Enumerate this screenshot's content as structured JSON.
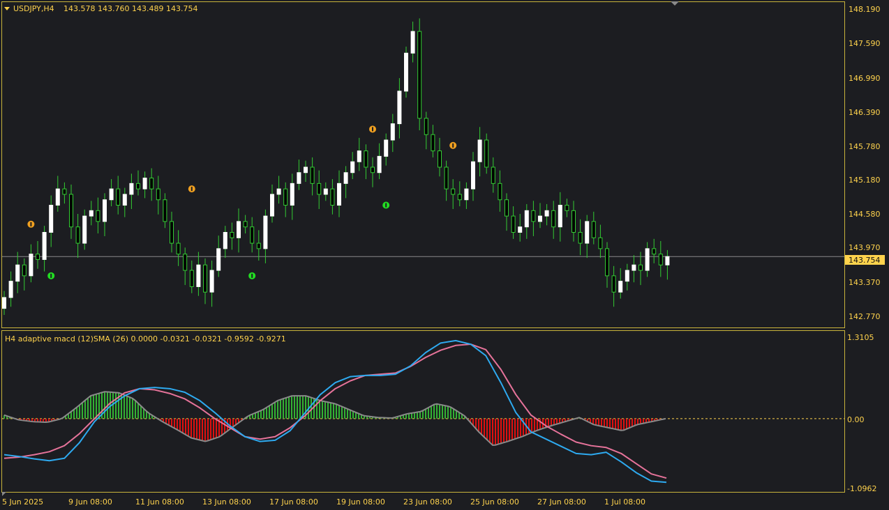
{
  "colors": {
    "background": "#1c1d21",
    "frame": "#c9b43c",
    "text": "#ffd34d",
    "bull_body": "#ffffff",
    "wick": "#33cc33",
    "current_line": "#8a8a8a",
    "current_label_bg": "#ffd34d",
    "current_label_text": "#111111",
    "macd_line": "#2eaaf0",
    "signal_line": "#e6739a",
    "hist_positive": "#33b233",
    "hist_negative": "#e01010",
    "hist_outline": "#8a8a8a",
    "up_marker": "#f0a020",
    "down_marker": "#22dd22",
    "zero_line": "#ffd34d"
  },
  "header": {
    "symbol": "USDJPY,H4",
    "ohlc": "143.578 143.760 143.489 143.754",
    "indicator_label": "H4 adaptive macd (12)SMA (26) 0.0000 -0.0321 -0.0321 -0.9592 -0.9271"
  },
  "price_axis": {
    "ticks": [
      "148.190",
      "147.590",
      "146.990",
      "146.390",
      "145.780",
      "145.180",
      "144.580",
      "143.970",
      "143.370",
      "142.770"
    ],
    "current_price": "143.754"
  },
  "indicator_axis": {
    "ticks": [
      "1.3105",
      "0.00",
      "-1.0962"
    ]
  },
  "time_axis": {
    "labels": [
      "5 Jun 2025",
      "9 Jun 08:00",
      "11 Jun 08:00",
      "13 Jun 08:00",
      "17 Jun 08:00",
      "19 Jun 08:00",
      "23 Jun 08:00",
      "25 Jun 08:00",
      "27 Jun 08:00",
      "1 Jul 08:00"
    ]
  },
  "chart_data": [
    {
      "type": "candlestick",
      "symbol": "USDJPY",
      "timeframe": "H4",
      "ylim": [
        142.5,
        148.35
      ],
      "current_price": 143.754,
      "closes": [
        143.0,
        143.3,
        143.6,
        143.4,
        143.8,
        143.7,
        144.2,
        144.7,
        145.0,
        144.9,
        144.3,
        144.0,
        144.5,
        144.6,
        144.4,
        144.8,
        145.0,
        144.7,
        144.9,
        145.1,
        145.0,
        145.2,
        145.0,
        144.8,
        144.4,
        144.0,
        143.8,
        143.5,
        143.2,
        143.6,
        143.1,
        143.5,
        143.9,
        144.2,
        144.1,
        144.4,
        144.3,
        144.0,
        143.9,
        144.5,
        144.9,
        145.0,
        144.7,
        145.1,
        145.3,
        145.4,
        145.1,
        144.9,
        145.0,
        144.7,
        145.1,
        145.3,
        145.5,
        145.7,
        145.4,
        145.3,
        145.6,
        145.9,
        146.2,
        146.8,
        147.5,
        147.9,
        146.3,
        146.0,
        145.7,
        145.4,
        145.0,
        144.9,
        144.8,
        145.0,
        145.5,
        145.9,
        145.4,
        145.1,
        144.8,
        144.5,
        144.2,
        144.3,
        144.6,
        144.4,
        144.5,
        144.6,
        144.3,
        144.7,
        144.6,
        144.2,
        144.0,
        144.4,
        144.1,
        143.9,
        143.4,
        143.1,
        143.3,
        143.5,
        143.6,
        143.5,
        143.9,
        143.8,
        143.6,
        143.754
      ],
      "up_markers": [
        {
          "index": 4,
          "price": 144.35
        },
        {
          "index": 28,
          "price": 145.0
        },
        {
          "index": 55,
          "price": 146.1
        },
        {
          "index": 67,
          "price": 145.8
        }
      ],
      "down_markers": [
        {
          "index": 7,
          "price": 143.4
        },
        {
          "index": 37,
          "price": 143.4
        },
        {
          "index": 57,
          "price": 144.7
        }
      ]
    },
    {
      "type": "line+histogram",
      "title": "H4 adaptive macd (12)SMA (26)",
      "ylim": [
        -1.15,
        1.38
      ],
      "zero": 0.0,
      "macd": [
        -0.6,
        -0.63,
        -0.67,
        -0.7,
        -0.66,
        -0.4,
        -0.05,
        0.2,
        0.38,
        0.5,
        0.52,
        0.5,
        0.44,
        0.3,
        0.1,
        -0.12,
        -0.3,
        -0.38,
        -0.36,
        -0.2,
        0.1,
        0.4,
        0.6,
        0.7,
        0.72,
        0.72,
        0.74,
        0.88,
        1.1,
        1.26,
        1.3,
        1.24,
        1.05,
        0.6,
        0.1,
        -0.22,
        -0.34,
        -0.46,
        -0.58,
        -0.6,
        -0.56,
        -0.72,
        -0.9,
        -1.04,
        -1.06
      ],
      "signal": [
        -0.66,
        -0.64,
        -0.6,
        -0.55,
        -0.45,
        -0.25,
        0.0,
        0.25,
        0.43,
        0.5,
        0.48,
        0.42,
        0.33,
        0.18,
        0.0,
        -0.15,
        -0.3,
        -0.34,
        -0.3,
        -0.15,
        0.05,
        0.3,
        0.5,
        0.63,
        0.72,
        0.74,
        0.76,
        0.87,
        1.02,
        1.14,
        1.22,
        1.24,
        1.15,
        0.82,
        0.4,
        0.06,
        -0.12,
        -0.26,
        -0.39,
        -0.45,
        -0.48,
        -0.58,
        -0.75,
        -0.92,
        -0.99
      ],
      "histogram": [
        0.06,
        -0.02,
        -0.05,
        -0.06,
        0.0,
        0.18,
        0.38,
        0.45,
        0.43,
        0.33,
        0.1,
        -0.05,
        -0.18,
        -0.32,
        -0.38,
        -0.3,
        -0.12,
        0.05,
        0.15,
        0.3,
        0.38,
        0.38,
        0.3,
        0.25,
        0.15,
        0.05,
        0.02,
        0.01,
        0.08,
        0.12,
        0.25,
        0.2,
        0.05,
        -0.22,
        -0.45,
        -0.38,
        -0.3,
        -0.2,
        -0.12,
        -0.05,
        0.02,
        -0.1,
        -0.15,
        -0.2,
        -0.1,
        -0.05,
        0.0
      ]
    }
  ]
}
